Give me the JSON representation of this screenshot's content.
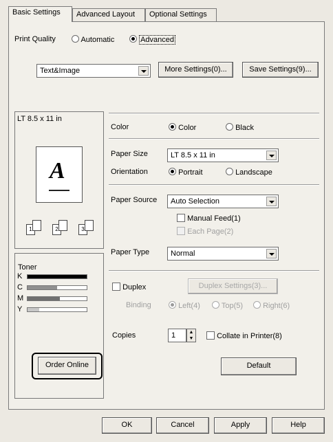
{
  "tabs": [
    {
      "label": "Basic Settings"
    },
    {
      "label": "Advanced Layout"
    },
    {
      "label": "Optional Settings"
    }
  ],
  "print_quality": {
    "label": "Print Quality",
    "automatic_label": "Automatic",
    "advanced_label": "Advanced",
    "selected": "Advanced",
    "mode_value": "Text&Image",
    "more_settings_label": "More Settings(0)...",
    "save_settings_label": "Save Settings(9)..."
  },
  "preview": {
    "paper_label": "LT 8.5 x 11 in",
    "sample_letter": "A",
    "copies_icons": [
      "1",
      "2",
      "3"
    ]
  },
  "toner": {
    "title": "Toner",
    "levels": [
      {
        "name": "K",
        "fraction": 1.0,
        "color": "#000000"
      },
      {
        "name": "C",
        "fraction": 0.5,
        "color": "#909090"
      },
      {
        "name": "M",
        "fraction": 0.55,
        "color": "#707070"
      },
      {
        "name": "Y",
        "fraction": 0.2,
        "color": "#c8c8c8"
      }
    ],
    "order_online_label": "Order Online"
  },
  "color": {
    "label": "Color",
    "color_option": "Color",
    "black_option": "Black",
    "selected": "Color"
  },
  "paper_size": {
    "label": "Paper Size",
    "value": "LT 8.5 x 11 in"
  },
  "orientation": {
    "label": "Orientation",
    "portrait": "Portrait",
    "landscape": "Landscape",
    "selected": "Portrait"
  },
  "paper_source": {
    "label": "Paper Source",
    "value": "Auto Selection",
    "manual_feed_label": "Manual Feed(1)",
    "each_page_label": "Each Page(2)"
  },
  "paper_type": {
    "label": "Paper Type",
    "value": "Normal"
  },
  "duplex": {
    "label": "Duplex",
    "settings_label": "Duplex Settings(3)...",
    "binding_label": "Binding",
    "left": "Left(4)",
    "top": "Top(5)",
    "right": "Right(6)"
  },
  "copies": {
    "label": "Copies",
    "value": "1",
    "collate_label": "Collate in Printer(8)"
  },
  "default_label": "Default",
  "dialog_buttons": {
    "ok": "OK",
    "cancel": "Cancel",
    "apply": "Apply",
    "help": "Help"
  }
}
